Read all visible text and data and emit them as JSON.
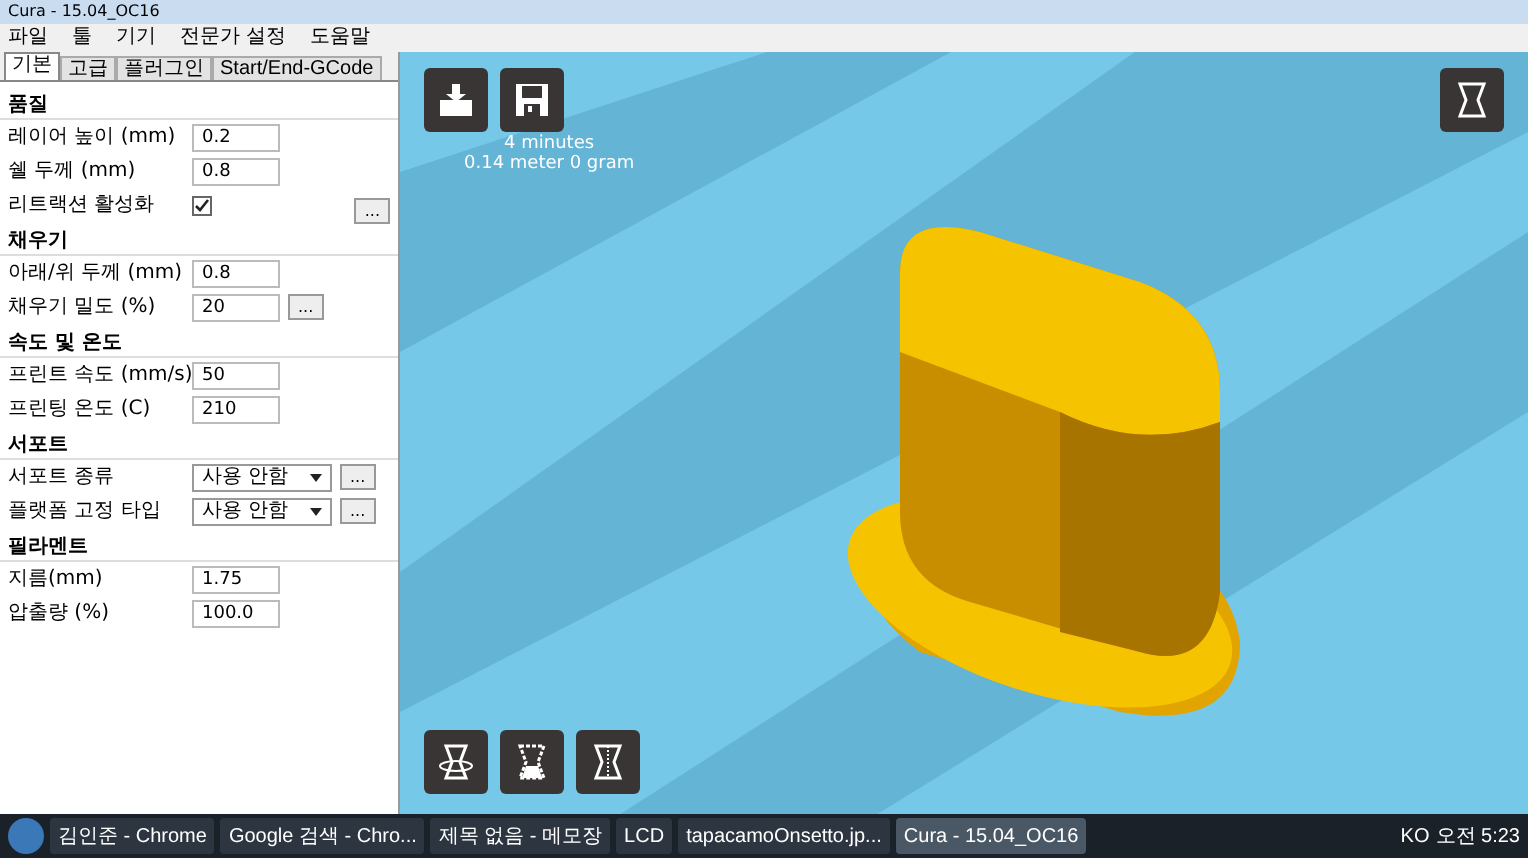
{
  "window": {
    "title": "Cura - 15.04_OC16"
  },
  "menu": [
    "파일",
    "툴",
    "기기",
    "전문가 설정",
    "도움말"
  ],
  "tabs": [
    {
      "label": "기본",
      "selected": true
    },
    {
      "label": "고급",
      "selected": false
    },
    {
      "label": "플러그인",
      "selected": false
    },
    {
      "label": "Start/End-GCode",
      "selected": false
    }
  ],
  "sections": [
    {
      "title": "품질",
      "rows": [
        {
          "kind": "text",
          "label": "레이어 높이 (mm)",
          "value": "0.2"
        },
        {
          "kind": "text",
          "label": "쉘 두께 (mm)",
          "value": "0.8"
        },
        {
          "kind": "check",
          "label": "리트랙션 활성화",
          "checked": true,
          "more": "..."
        }
      ]
    },
    {
      "title": "채우기",
      "rows": [
        {
          "kind": "text",
          "label": "아래/위 두께 (mm)",
          "value": "0.8"
        },
        {
          "kind": "text",
          "label": "채우기 밀도 (%)",
          "value": "20",
          "more": "..."
        }
      ]
    },
    {
      "title": "속도 및 온도",
      "rows": [
        {
          "kind": "text",
          "label": "프린트 속도 (mm/s)",
          "value": "50"
        },
        {
          "kind": "text",
          "label": "프린팅 온도 (C)",
          "value": "210"
        }
      ]
    },
    {
      "title": "서포트",
      "rows": [
        {
          "kind": "select",
          "label": "서포트 종류",
          "value": "사용 안함",
          "more": "..."
        },
        {
          "kind": "select",
          "label": "플랫폼 고정 타입",
          "value": "사용 안함",
          "more": "..."
        }
      ]
    },
    {
      "title": "필라멘트",
      "rows": [
        {
          "kind": "text",
          "label": "지름(mm)",
          "value": "1.75"
        },
        {
          "kind": "text",
          "label": "압출량 (%)",
          "value": "100.0"
        }
      ]
    }
  ],
  "print_info": [
    "4 minutes",
    "0.14 meter 0 gram"
  ],
  "taskbar": {
    "items": [
      {
        "label": "김인준 - Chrome",
        "selected": false
      },
      {
        "label": "Google 검색 - Chro...",
        "selected": false
      },
      {
        "label": "제목 없음 - 메모장",
        "selected": false
      },
      {
        "label": "LCD",
        "selected": false
      },
      {
        "label": "tapacamoOnsetto.jp...",
        "selected": false
      },
      {
        "label": "Cura - 15.04_OC16",
        "selected": true
      }
    ],
    "tray": [
      "KO",
      "오전 5:23"
    ]
  }
}
